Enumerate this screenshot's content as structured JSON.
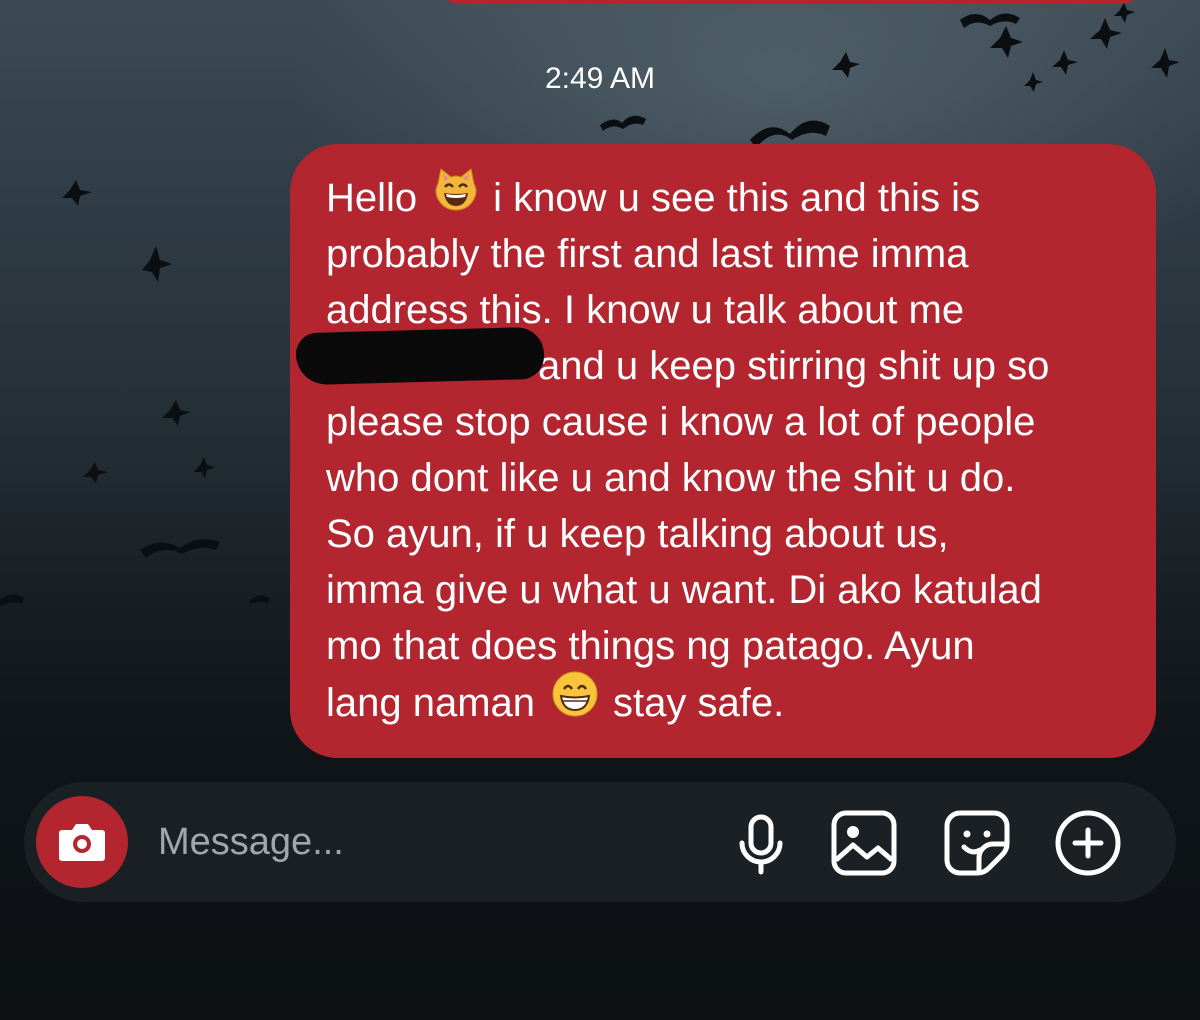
{
  "conversation": {
    "timestamp": "2:49 AM",
    "message": {
      "lines": [
        "Hello",
        "i know u see this and this is",
        "probably the first and last time imma",
        "address this. I know u talk about me",
        "and u keep stirring shit up so",
        "please stop cause i know a lot of people",
        "who dont like u and know the shit u do.",
        "So ayun, if u keep talking about us,",
        "imma give u what u want. Di ako katulad",
        "mo that does things ng patago. Ayun",
        "lang naman",
        "stay safe."
      ],
      "emojis": [
        "grinning-cat-emoji",
        "grinning-face-emoji"
      ],
      "bubble_color": "#b3262f"
    }
  },
  "composer": {
    "placeholder": "Message...",
    "icons": [
      "camera-icon",
      "microphone-icon",
      "gallery-icon",
      "sticker-icon",
      "plus-icon"
    ],
    "accent": "#b3262f"
  }
}
